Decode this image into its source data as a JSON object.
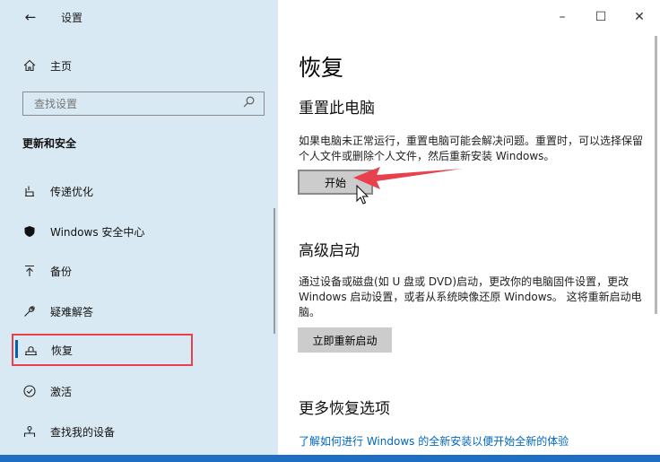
{
  "window": {
    "title": "设置",
    "controls": {
      "minimize": "–",
      "maximize": "☐",
      "close": "✕"
    }
  },
  "sidebar": {
    "back_icon": "←",
    "home_label": "主页",
    "search_placeholder": "查找设置",
    "section_title": "更新和安全",
    "items": [
      {
        "label": "传递优化",
        "icon": "delivery-optimization-icon"
      },
      {
        "label": "Windows 安全中心",
        "icon": "shield-icon"
      },
      {
        "label": "备份",
        "icon": "backup-icon"
      },
      {
        "label": "疑难解答",
        "icon": "wrench-icon"
      },
      {
        "label": "恢复",
        "icon": "recovery-icon",
        "selected": true
      },
      {
        "label": "激活",
        "icon": "check-circle-icon"
      },
      {
        "label": "查找我的设备",
        "icon": "find-device-icon"
      }
    ]
  },
  "main": {
    "title": "恢复",
    "reset": {
      "heading": "重置此电脑",
      "description": "如果电脑未正常运行，重置电脑可能会解决问题。重置时，可以选择保留个人文件或删除个人文件，然后重新安装 Windows。",
      "button": "开始"
    },
    "advanced": {
      "heading": "高级启动",
      "description": "通过设备或磁盘(如 U 盘或 DVD)启动，更改你的电脑固件设置，更改 Windows 启动设置，或者从系统映像还原 Windows。 这将重新启动电脑。",
      "button": "立即重新启动"
    },
    "more": {
      "heading": "更多恢复选项",
      "link": "了解如何进行 Windows 的全新安装以便开始全新的体验"
    }
  },
  "colors": {
    "sidebar_bg": "#d9e9f3",
    "accent": "#0063b1",
    "highlight_box": "#e8414d",
    "link": "#0067c0",
    "button": "#cccccc"
  }
}
